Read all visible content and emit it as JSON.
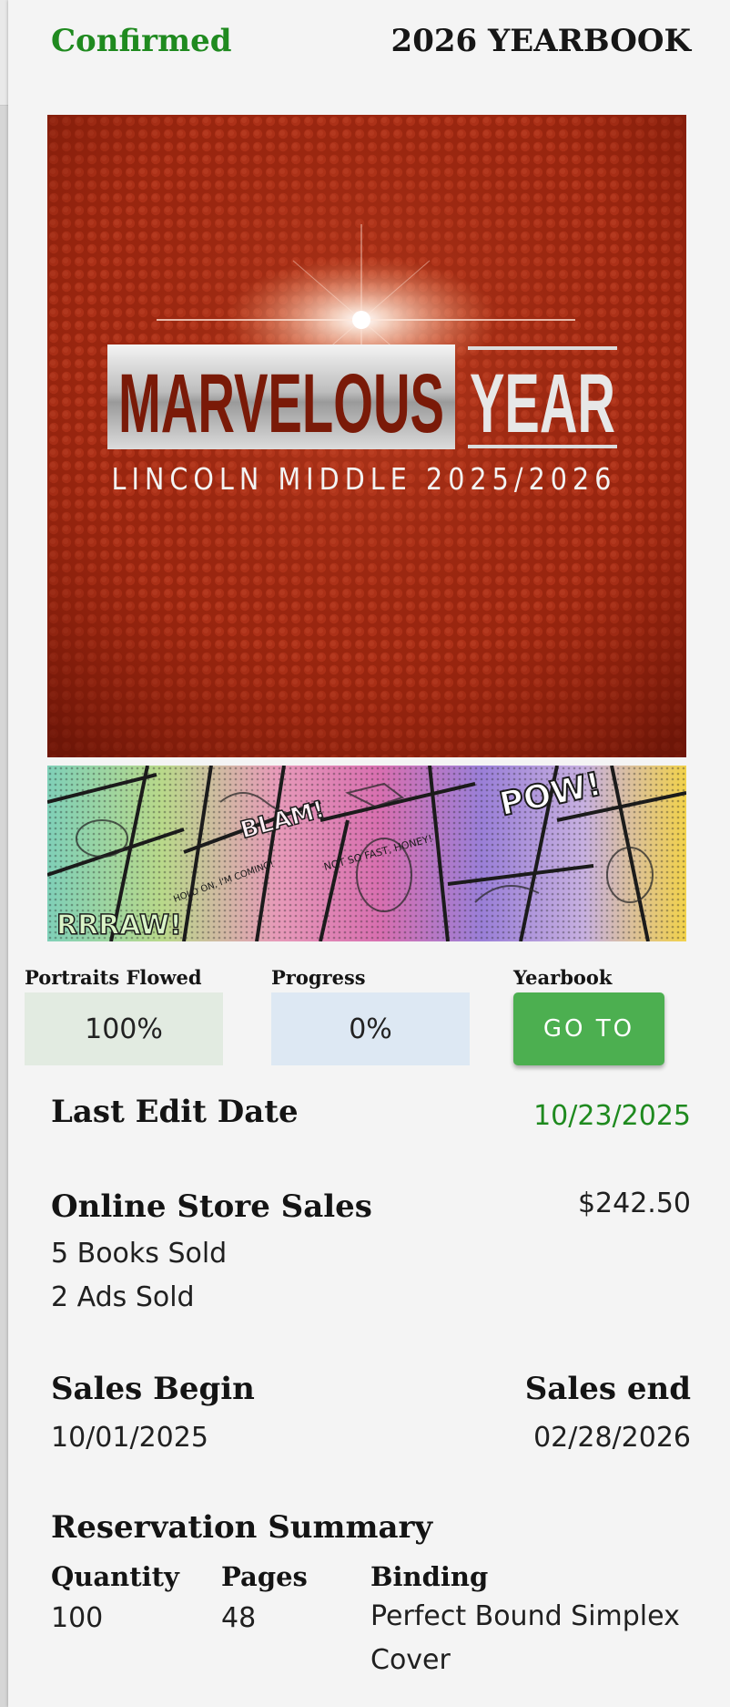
{
  "header": {
    "status": "Confirmed",
    "title": "2026 YEARBOOK"
  },
  "cover": {
    "headline_left": "MARVELOUS",
    "headline_right": "YEAR",
    "subtitle": "LINCOLN MIDDLE 2025/2026",
    "colors": {
      "background": "#a32a12",
      "accent": "#e5e5e5"
    }
  },
  "comic_band": {
    "captions": [
      "POW!",
      "BLAM!",
      "NOT SO FAST, HONEY!",
      "HOLD ON, I'M COMING!",
      "RRRAW!"
    ]
  },
  "stats": {
    "portraits_label": "Portraits Flowed",
    "portraits_value": "100%",
    "portraits_fraction": 1.0,
    "progress_label": "Progress",
    "progress_value": "0%",
    "progress_fraction": 0.0,
    "yearbook_label": "Yearbook",
    "goto_label": "GO TO"
  },
  "last_edit": {
    "label": "Last Edit Date",
    "value": "10/23/2025"
  },
  "online_store": {
    "label": "Online Store Sales",
    "amount": "$242.50",
    "books": "5 Books Sold",
    "ads": "2 Ads Sold"
  },
  "sales_window": {
    "begin_label": "Sales Begin",
    "begin_date": "10/01/2025",
    "end_label": "Sales end",
    "end_date": "02/28/2026"
  },
  "reservation": {
    "title": "Reservation Summary",
    "quantity_label": "Quantity",
    "quantity_value": "100",
    "pages_label": "Pages",
    "pages_value": "48",
    "binding_label": "Binding",
    "binding_value": "Perfect Bound Simplex Cover"
  },
  "colors": {
    "status_green": "#1f8a1f",
    "button_green": "#4caf50",
    "portraits_bg": "#e2ebe1",
    "progress_bg": "#dde8f3"
  }
}
